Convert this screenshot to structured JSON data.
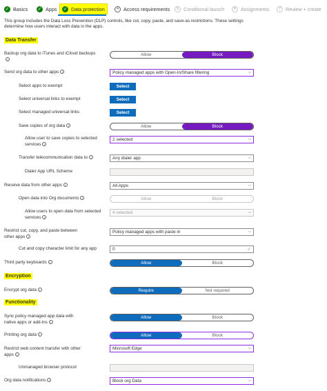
{
  "steps": [
    {
      "label": "Basics",
      "state": "done",
      "glyph": "✓"
    },
    {
      "label": "Apps",
      "state": "done",
      "glyph": "✓"
    },
    {
      "label": "Data protection",
      "state": "active",
      "glyph": "✓"
    },
    {
      "label": "Access requirements",
      "state": "num",
      "glyph": "4"
    },
    {
      "label": "Conditional launch",
      "state": "future",
      "glyph": "5"
    },
    {
      "label": "Assignments",
      "state": "future",
      "glyph": "6"
    },
    {
      "label": "Review + create",
      "state": "future",
      "glyph": "7"
    }
  ],
  "description": "This group includes the Data Loss Prevention (DLP) controls, like cut, copy, paste, and save-as restrictions. These settings determine how users interact with data in the apps.",
  "sections": {
    "data_transfer": "Data Transfer",
    "encryption": "Encryption",
    "functionality": "Functionality"
  },
  "settings": {
    "backup": {
      "label": "Backup org data to iTunes and iCloud backups",
      "allow": "Allow",
      "block": "Block"
    },
    "send_org_data": {
      "label": "Send org data to other apps",
      "value": "Policy managed apps with Open-In/Share filtering"
    },
    "apps_exempt": {
      "label": "Select apps to exempt",
      "button": "Select"
    },
    "universal_links": {
      "label": "Select universal links to exempt",
      "button": "Select"
    },
    "managed_links": {
      "label": "Select managed universal links",
      "button": "Select"
    },
    "save_copies": {
      "label": "Save copies of org data",
      "allow": "Allow",
      "block": "Block"
    },
    "save_services": {
      "label": "Allow user to save copies to selected services",
      "value": "2 selected"
    },
    "telecom": {
      "label": "Transfer telecommunication data to",
      "value": "Any dialer app"
    },
    "dialer_scheme": {
      "label": "Dialer App URL Scheme",
      "value": ""
    },
    "receive_data": {
      "label": "Receive data from other apps",
      "value": "All Apps"
    },
    "open_into_org": {
      "label": "Open data into Org documents",
      "allow": "Allow",
      "block": "Block"
    },
    "open_from_services": {
      "label": "Allow users to open data from selected services",
      "value": "4 selected"
    },
    "restrict_cut": {
      "label": "Restrict cut, copy, and paste between other apps",
      "value": "Policy managed apps with paste in"
    },
    "char_limit": {
      "label": "Cut and copy character limit for any app",
      "value": "0"
    },
    "third_party_kb": {
      "label": "Third party keyboards",
      "allow": "Allow",
      "block": "Block"
    },
    "encrypt": {
      "label": "Encrypt org data",
      "require": "Require",
      "not_required": "Not required"
    },
    "sync": {
      "label": "Sync policy managed app data with native apps or add-ins",
      "allow": "Allow",
      "block": "Block"
    },
    "printing": {
      "label": "Printing org data",
      "allow": "Allow",
      "block": "Block"
    },
    "web_content": {
      "label": "Restrict web content transfer with other apps",
      "value": "Microsoft Edge"
    },
    "unmanaged_protocol": {
      "label": "Unmanaged browser protocol",
      "value": ""
    },
    "notifications": {
      "label": "Org data notifications",
      "value": "Block org Data"
    }
  },
  "icons": {
    "info": "i",
    "chevron": "⌵",
    "check": "✓"
  },
  "colors": {
    "accent": "#0f6cbd",
    "selected_purple": "#7519c1",
    "highlight": "#ffff00",
    "done_green": "#107c10"
  }
}
